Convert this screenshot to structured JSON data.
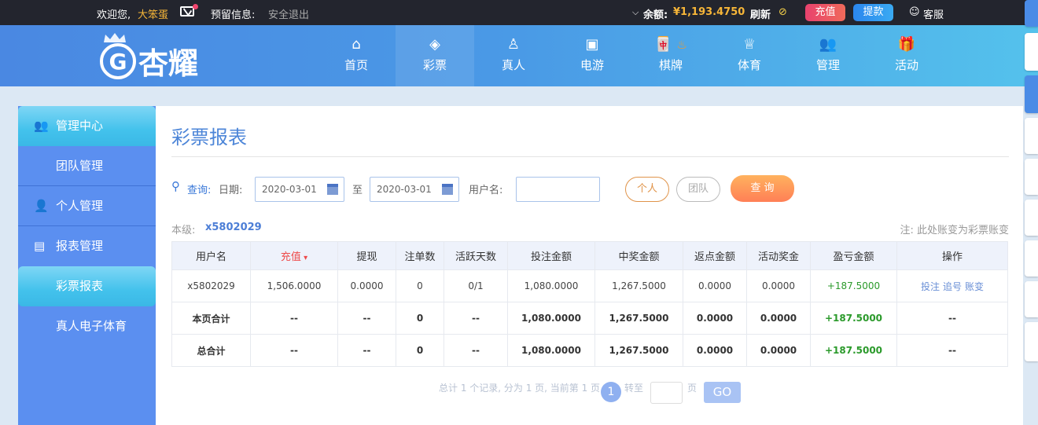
{
  "topbar": {
    "welcome": "欢迎您,",
    "username": "大笨蛋",
    "reserved_info": "预留信息:",
    "logout": "安全退出",
    "balance_label": "余额:",
    "balance": "¥1,193.4750",
    "refresh": "刷新",
    "deposit": "充值",
    "withdraw": "提款",
    "service": "客服"
  },
  "logo": {
    "text": "杏耀"
  },
  "nav": [
    {
      "label": "首页",
      "icon": "home-icon"
    },
    {
      "label": "彩票",
      "icon": "lottery-icon"
    },
    {
      "label": "真人",
      "icon": "live-icon"
    },
    {
      "label": "电游",
      "icon": "slots-icon"
    },
    {
      "label": "棋牌",
      "icon": "mahjong-icon"
    },
    {
      "label": "体育",
      "icon": "trophy-icon"
    },
    {
      "label": "管理",
      "icon": "users-icon"
    },
    {
      "label": "活动",
      "icon": "gift-icon"
    }
  ],
  "sidebar": {
    "center": "管理中心",
    "team": "团队管理",
    "personal": "个人管理",
    "reports": "报表管理",
    "lottery_report": "彩票报表",
    "live_report": "真人电子体育"
  },
  "main": {
    "title": "彩票报表",
    "query_label": "查询:",
    "date_label": "日期:",
    "date_from": "2020-03-01",
    "to": "至",
    "date_to": "2020-03-01",
    "username_label": "用户名:",
    "username_value": "",
    "btn_personal": "个人",
    "btn_team": "团队",
    "btn_search": "查 询",
    "level_label": "本级:",
    "level_user": "x5802029",
    "note": "注: 此处账变为彩票账变"
  },
  "table": {
    "headers": [
      "用户名",
      "充值",
      "提现",
      "注单数",
      "活跃天数",
      "投注金额",
      "中奖金额",
      "返点金额",
      "活动奖金",
      "盈亏金额",
      "操作"
    ],
    "rows": [
      [
        "x5802029",
        "1,506.0000",
        "0.0000",
        "0",
        "0/1",
        "1,080.0000",
        "1,267.5000",
        "0.0000",
        "0.0000",
        "+187.5000",
        ""
      ]
    ],
    "actions": [
      "投注",
      "追号",
      "账变"
    ],
    "totals": [
      [
        "本页合计",
        "--",
        "--",
        "0",
        "--",
        "1,080.0000",
        "1,267.5000",
        "0.0000",
        "0.0000",
        "+187.5000",
        "--"
      ],
      [
        "总合计",
        "--",
        "--",
        "0",
        "--",
        "1,080.0000",
        "1,267.5000",
        "0.0000",
        "0.0000",
        "+187.5000",
        "--"
      ]
    ]
  },
  "pager": {
    "summary": "总计 1 个记录, 分为 1 页, 当前第 1 页",
    "current": "1",
    "goto": "转至",
    "page_unit": "页",
    "go": "GO"
  },
  "colors": {
    "accent": "#5b8ff0",
    "profit": "#2b9a2b",
    "deposit": "#e84a6c",
    "withdraw": "#2f8ff0"
  }
}
